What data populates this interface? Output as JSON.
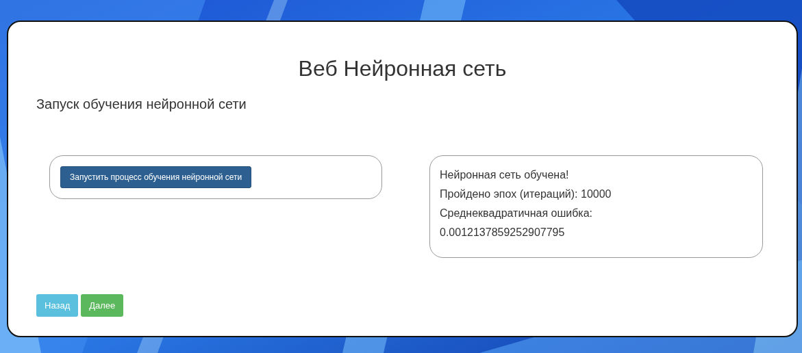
{
  "page": {
    "title": "Веб Нейронная сеть",
    "subtitle": "Запуск обучения нейронной сети"
  },
  "train_button": {
    "label": "Запустить процесс обучения нейронной сети"
  },
  "result": {
    "lines": [
      "Нейронная сеть обучена!",
      "Пройдено эпох (итераций): 10000",
      "Среднеквадратичная ошибка:",
      "0.0012137859252907795"
    ]
  },
  "nav_buttons": [
    {
      "label": "Назад",
      "kind": "back"
    },
    {
      "label": "Далее",
      "kind": "next"
    }
  ]
}
